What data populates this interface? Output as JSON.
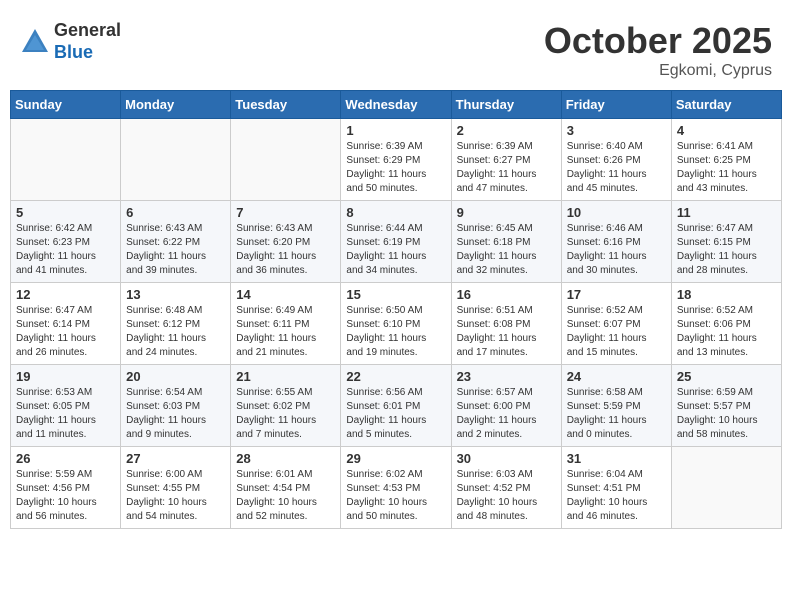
{
  "header": {
    "logo_general": "General",
    "logo_blue": "Blue",
    "month_title": "October 2025",
    "location": "Egkomi, Cyprus"
  },
  "weekdays": [
    "Sunday",
    "Monday",
    "Tuesday",
    "Wednesday",
    "Thursday",
    "Friday",
    "Saturday"
  ],
  "weeks": [
    [
      {
        "day": "",
        "info": ""
      },
      {
        "day": "",
        "info": ""
      },
      {
        "day": "",
        "info": ""
      },
      {
        "day": "1",
        "info": "Sunrise: 6:39 AM\nSunset: 6:29 PM\nDaylight: 11 hours\nand 50 minutes."
      },
      {
        "day": "2",
        "info": "Sunrise: 6:39 AM\nSunset: 6:27 PM\nDaylight: 11 hours\nand 47 minutes."
      },
      {
        "day": "3",
        "info": "Sunrise: 6:40 AM\nSunset: 6:26 PM\nDaylight: 11 hours\nand 45 minutes."
      },
      {
        "day": "4",
        "info": "Sunrise: 6:41 AM\nSunset: 6:25 PM\nDaylight: 11 hours\nand 43 minutes."
      }
    ],
    [
      {
        "day": "5",
        "info": "Sunrise: 6:42 AM\nSunset: 6:23 PM\nDaylight: 11 hours\nand 41 minutes."
      },
      {
        "day": "6",
        "info": "Sunrise: 6:43 AM\nSunset: 6:22 PM\nDaylight: 11 hours\nand 39 minutes."
      },
      {
        "day": "7",
        "info": "Sunrise: 6:43 AM\nSunset: 6:20 PM\nDaylight: 11 hours\nand 36 minutes."
      },
      {
        "day": "8",
        "info": "Sunrise: 6:44 AM\nSunset: 6:19 PM\nDaylight: 11 hours\nand 34 minutes."
      },
      {
        "day": "9",
        "info": "Sunrise: 6:45 AM\nSunset: 6:18 PM\nDaylight: 11 hours\nand 32 minutes."
      },
      {
        "day": "10",
        "info": "Sunrise: 6:46 AM\nSunset: 6:16 PM\nDaylight: 11 hours\nand 30 minutes."
      },
      {
        "day": "11",
        "info": "Sunrise: 6:47 AM\nSunset: 6:15 PM\nDaylight: 11 hours\nand 28 minutes."
      }
    ],
    [
      {
        "day": "12",
        "info": "Sunrise: 6:47 AM\nSunset: 6:14 PM\nDaylight: 11 hours\nand 26 minutes."
      },
      {
        "day": "13",
        "info": "Sunrise: 6:48 AM\nSunset: 6:12 PM\nDaylight: 11 hours\nand 24 minutes."
      },
      {
        "day": "14",
        "info": "Sunrise: 6:49 AM\nSunset: 6:11 PM\nDaylight: 11 hours\nand 21 minutes."
      },
      {
        "day": "15",
        "info": "Sunrise: 6:50 AM\nSunset: 6:10 PM\nDaylight: 11 hours\nand 19 minutes."
      },
      {
        "day": "16",
        "info": "Sunrise: 6:51 AM\nSunset: 6:08 PM\nDaylight: 11 hours\nand 17 minutes."
      },
      {
        "day": "17",
        "info": "Sunrise: 6:52 AM\nSunset: 6:07 PM\nDaylight: 11 hours\nand 15 minutes."
      },
      {
        "day": "18",
        "info": "Sunrise: 6:52 AM\nSunset: 6:06 PM\nDaylight: 11 hours\nand 13 minutes."
      }
    ],
    [
      {
        "day": "19",
        "info": "Sunrise: 6:53 AM\nSunset: 6:05 PM\nDaylight: 11 hours\nand 11 minutes."
      },
      {
        "day": "20",
        "info": "Sunrise: 6:54 AM\nSunset: 6:03 PM\nDaylight: 11 hours\nand 9 minutes."
      },
      {
        "day": "21",
        "info": "Sunrise: 6:55 AM\nSunset: 6:02 PM\nDaylight: 11 hours\nand 7 minutes."
      },
      {
        "day": "22",
        "info": "Sunrise: 6:56 AM\nSunset: 6:01 PM\nDaylight: 11 hours\nand 5 minutes."
      },
      {
        "day": "23",
        "info": "Sunrise: 6:57 AM\nSunset: 6:00 PM\nDaylight: 11 hours\nand 2 minutes."
      },
      {
        "day": "24",
        "info": "Sunrise: 6:58 AM\nSunset: 5:59 PM\nDaylight: 11 hours\nand 0 minutes."
      },
      {
        "day": "25",
        "info": "Sunrise: 6:59 AM\nSunset: 5:57 PM\nDaylight: 10 hours\nand 58 minutes."
      }
    ],
    [
      {
        "day": "26",
        "info": "Sunrise: 5:59 AM\nSunset: 4:56 PM\nDaylight: 10 hours\nand 56 minutes."
      },
      {
        "day": "27",
        "info": "Sunrise: 6:00 AM\nSunset: 4:55 PM\nDaylight: 10 hours\nand 54 minutes."
      },
      {
        "day": "28",
        "info": "Sunrise: 6:01 AM\nSunset: 4:54 PM\nDaylight: 10 hours\nand 52 minutes."
      },
      {
        "day": "29",
        "info": "Sunrise: 6:02 AM\nSunset: 4:53 PM\nDaylight: 10 hours\nand 50 minutes."
      },
      {
        "day": "30",
        "info": "Sunrise: 6:03 AM\nSunset: 4:52 PM\nDaylight: 10 hours\nand 48 minutes."
      },
      {
        "day": "31",
        "info": "Sunrise: 6:04 AM\nSunset: 4:51 PM\nDaylight: 10 hours\nand 46 minutes."
      },
      {
        "day": "",
        "info": ""
      }
    ]
  ]
}
